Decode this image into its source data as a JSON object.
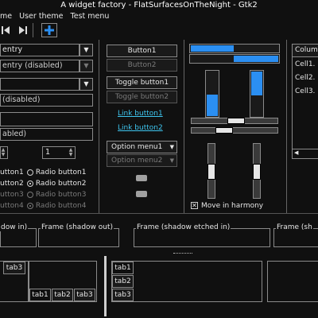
{
  "window": {
    "title": "A widget factory - FlatSurfacesOnTheNight - Gtk2"
  },
  "menu": {
    "items": [
      "me",
      "User theme",
      "Test menu"
    ]
  },
  "toolbar": {
    "icons": [
      "skip-back-icon",
      "skip-forward-icon",
      "add-icon"
    ]
  },
  "combos": {
    "entry": "entry",
    "entry_disabled": "entry (disabled)",
    "combo_disabled": "(disabled)",
    "plain_entry": "",
    "entry_disabled2": "abled)"
  },
  "spin": {
    "value": "1"
  },
  "radios": {
    "col_a": [
      "utton1",
      "utton2",
      "utton3",
      "utton4"
    ],
    "col_b": [
      "Radio button1",
      "Radio button2",
      "Radio button3",
      "Radio button4"
    ]
  },
  "buttons": {
    "button1": "Button1",
    "button2": "Button2",
    "toggle1": "Toggle button1",
    "toggle2": "Toggle button2",
    "link1": "Link button1",
    "link2": "Link button2",
    "option1": "Option menu1",
    "option2": "Option menu2"
  },
  "progress": {
    "bar1": 0.48,
    "bar2": 0.52,
    "vbar1": 0.45,
    "vbar2": 0.52
  },
  "scales": {
    "h1": 0.55,
    "h2": 0.3,
    "v1": 0.45,
    "v2": 0.5
  },
  "move_in_harmony": {
    "label": "Move in harmony",
    "checked": true
  },
  "tree": {
    "header": "Column",
    "cells": [
      "Cell1.",
      "Cell2.",
      "Cell3."
    ]
  },
  "frames": [
    "dow in)",
    "Frame (shadow out)",
    "Frame (shadow etched in)",
    "Frame (sh"
  ],
  "notebooks": {
    "nb1_tabs": [
      "tab3"
    ],
    "nb2_tabs": [
      "tab1",
      "tab2",
      "tab3"
    ],
    "nb3_tabs": [
      "tab1",
      "tab2",
      "tab3"
    ]
  }
}
